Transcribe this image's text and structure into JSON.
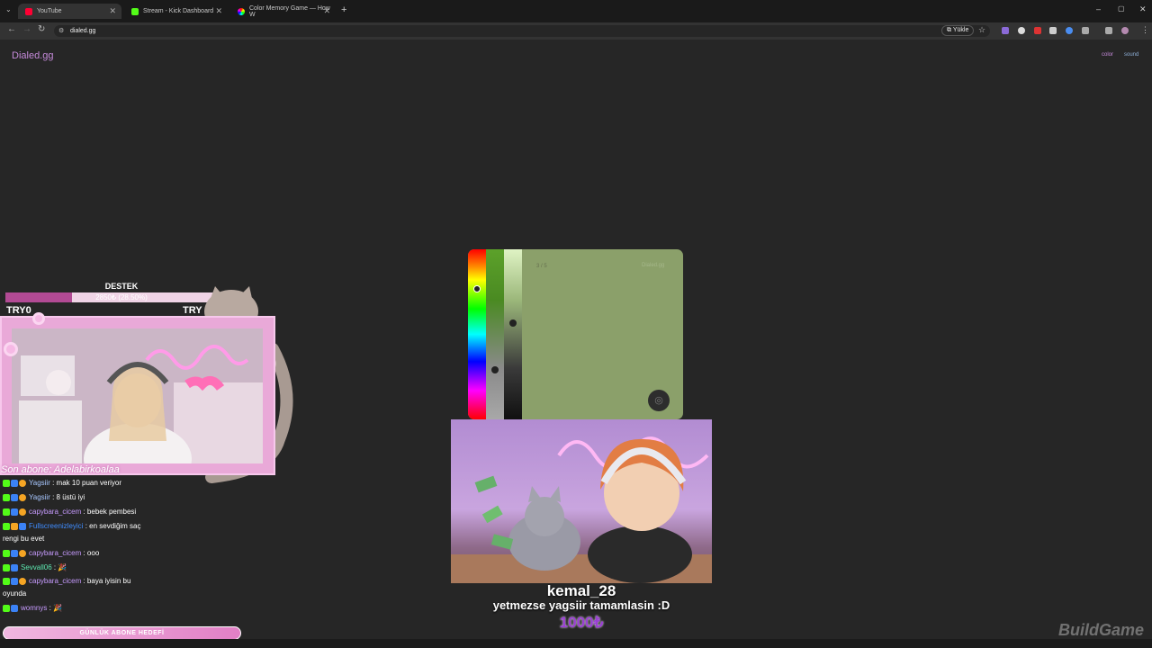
{
  "browser": {
    "tabs": [
      {
        "label": "YouTube",
        "color": "#ff0033"
      },
      {
        "label": "Stream - Kick Dashboard",
        "color": "#53fc18"
      },
      {
        "label": "Color Memory Game — How W",
        "color": "#c68bdb"
      }
    ],
    "url": "dialed.gg",
    "install_label": "Yükle"
  },
  "site": {
    "brand": "Dialed.gg",
    "nav": [
      "color",
      "sound"
    ]
  },
  "game": {
    "counter": "3 / 5",
    "watermark": "Dialed.gg",
    "current_color": "#8ba06a",
    "hue_level": 0.22,
    "saturation_level": 0.72,
    "brightness_level": 0.43
  },
  "overlay": {
    "goal_title": "DESTEK",
    "goal_text": "2850₺ (28.50%)",
    "goal_fraction": 0.285,
    "try_left": "TRY0",
    "try_right": "TRY",
    "last_sub": "Son abone: Adelabirkoalaa",
    "daily_goal": "GÜNLÜK ABONE HEDEFİ"
  },
  "donation": {
    "donor": "kemal_28",
    "message": "yetmezse yagsiir tamamlasin :D",
    "amount": "1000₺"
  },
  "chat": [
    {
      "user": "Yagsiir",
      "text": ": mak 10 puan veriyor",
      "color": "#a8c7ff"
    },
    {
      "user": "Yagsiir",
      "text": ": 8 üstü iyi",
      "color": "#a8c7ff"
    },
    {
      "user": "capybara_cicem",
      "text": ": bebek pembesi",
      "color": "#c79bff"
    },
    {
      "user": "Fullscreenizleyici",
      "text": ": en sevdiğim saç",
      "color": "#3f8cff",
      "cont": "rengi bu evet"
    },
    {
      "user": "capybara_cicem",
      "text": ": ooo",
      "color": "#c79bff"
    },
    {
      "user": "Sevvall06",
      "text": ": 🎉",
      "color": "#5de8b0"
    },
    {
      "user": "capybara_cicem",
      "text": ": baya iyisin bu",
      "color": "#c79bff",
      "cont": "oyunda"
    },
    {
      "user": "womnys",
      "text": ": 🎉",
      "color": "#c79bff"
    }
  ]
}
